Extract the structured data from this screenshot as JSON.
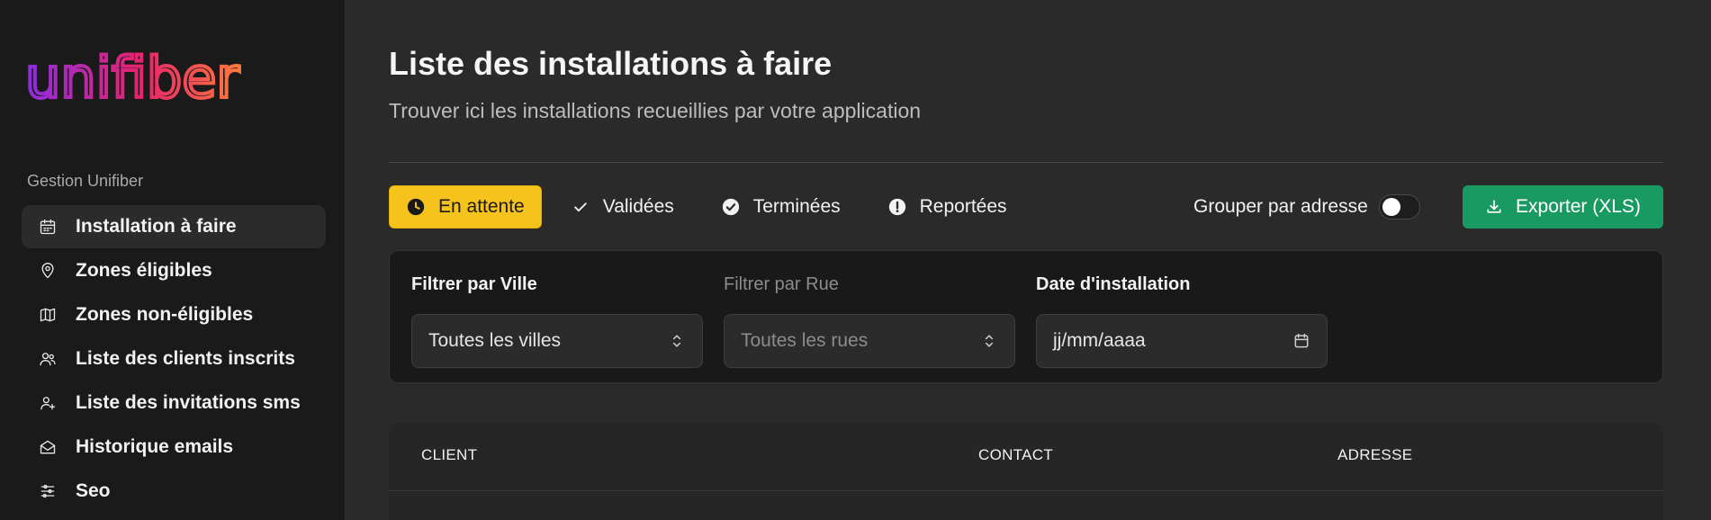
{
  "brand": {
    "logo_text": "unifiber",
    "gradient_start": "#8e2de2",
    "gradient_mid": "#e8246b",
    "gradient_end": "#ff7a3d"
  },
  "sidebar": {
    "section_label": "Gestion Unifiber",
    "items": [
      {
        "label": "Installation à faire",
        "icon": "calendar-icon",
        "active": true
      },
      {
        "label": "Zones éligibles",
        "icon": "map-pin-icon"
      },
      {
        "label": "Zones non-éligibles",
        "icon": "map-icon"
      },
      {
        "label": "Liste des clients inscrits",
        "icon": "users-icon"
      },
      {
        "label": "Liste des invitations sms",
        "icon": "user-plus-icon"
      },
      {
        "label": "Historique emails",
        "icon": "mail-open-icon"
      },
      {
        "label": "Seo",
        "icon": "sliders-icon"
      }
    ]
  },
  "header": {
    "title": "Liste des installations à faire",
    "subtitle": "Trouver ici les installations recueillies par votre application"
  },
  "tabs": [
    {
      "label": "En attente",
      "icon": "clock-icon",
      "active": true
    },
    {
      "label": "Validées",
      "icon": "check-icon"
    },
    {
      "label": "Terminées",
      "icon": "check-circle-icon"
    },
    {
      "label": "Reportées",
      "icon": "alert-circle-icon"
    }
  ],
  "group_toggle": {
    "label": "Grouper par adresse",
    "on": false
  },
  "export": {
    "label": "Exporter (XLS)",
    "icon": "download-icon",
    "color": "#1a9a63"
  },
  "filters": {
    "city": {
      "label": "Filtrer par Ville",
      "value": "Toutes les villes"
    },
    "street": {
      "label": "Filtrer par Rue",
      "value": "Toutes les rues"
    },
    "date": {
      "label": "Date d'installation",
      "placeholder": "jj/mm/aaaa"
    }
  },
  "table": {
    "columns": [
      "CLIENT",
      "CONTACT",
      "ADRESSE"
    ]
  },
  "colors": {
    "accent": "#f6c21c",
    "sidebar_bg": "#1a1a1a",
    "page_bg": "#2a2a2a"
  }
}
